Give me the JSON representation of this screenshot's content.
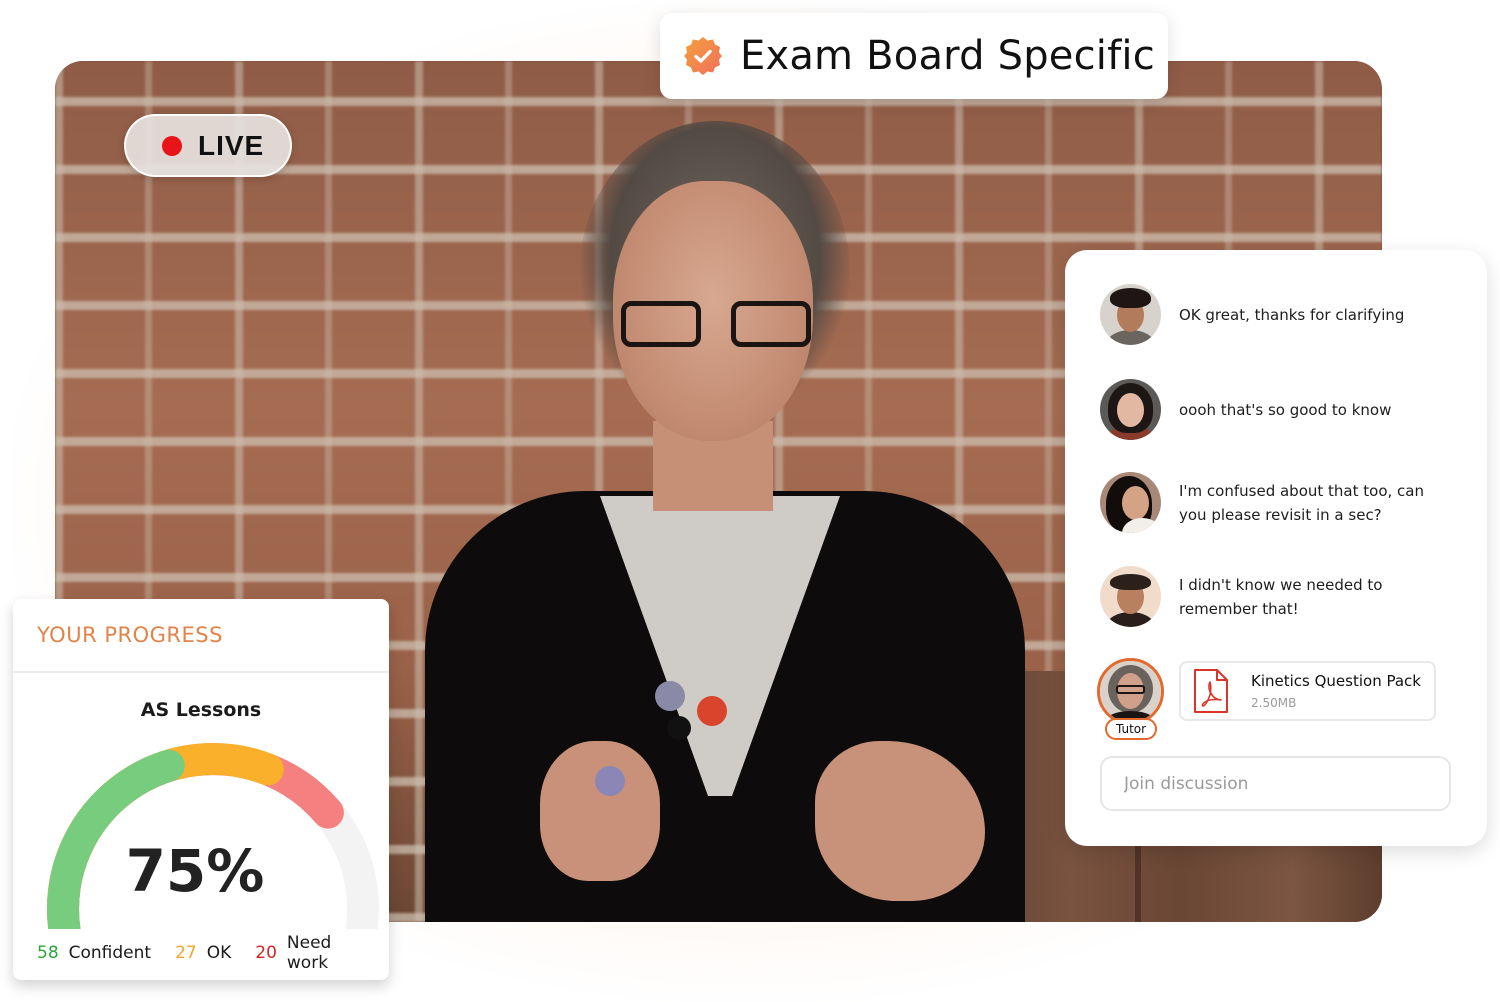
{
  "badge": {
    "label": "Exam Board Specific",
    "icon": "verified-check-badge-icon",
    "icon_gradient": [
      "#f4a13c",
      "#ef6f5e"
    ]
  },
  "video": {
    "live_label": "LIVE",
    "live_color": "#e8141a"
  },
  "progress": {
    "title": "YOUR PROGRESS",
    "subtitle": "AS Lessons",
    "value_label": "75%",
    "value_percent": 75,
    "segments": [
      {
        "name": "Confident",
        "count": 58,
        "count_label": "58",
        "color": "#77cc7d",
        "text_color": "#2aa53a"
      },
      {
        "name": "OK",
        "count": 27,
        "count_label": "27",
        "color": "#fbb02c",
        "text_color": "#f0a62a"
      },
      {
        "name": "Need work",
        "count": 20,
        "count_label": "20",
        "color": "#f48080",
        "text_color": "#d62424"
      }
    ],
    "track_color": "#f3f3f3",
    "title_color": "#e2834a"
  },
  "chat": {
    "messages": [
      {
        "avatar": "student-avatar-1",
        "text": "OK great, thanks for clarifying"
      },
      {
        "avatar": "student-avatar-2",
        "text": "oooh that's so good to know"
      },
      {
        "avatar": "student-avatar-3",
        "text": "I'm confused about that too, can you please revisit in a sec?"
      },
      {
        "avatar": "student-avatar-4",
        "text": "I didn't know we needed to remember that!"
      }
    ],
    "tutor": {
      "badge_label": "Tutor",
      "accent": "#e2692f"
    },
    "attachment": {
      "name": "Kinetics Question Pack",
      "size": "2.50MB",
      "icon": "pdf-file-icon",
      "icon_color": "#d9352a"
    },
    "input": {
      "placeholder": "Join discussion",
      "value": ""
    }
  }
}
